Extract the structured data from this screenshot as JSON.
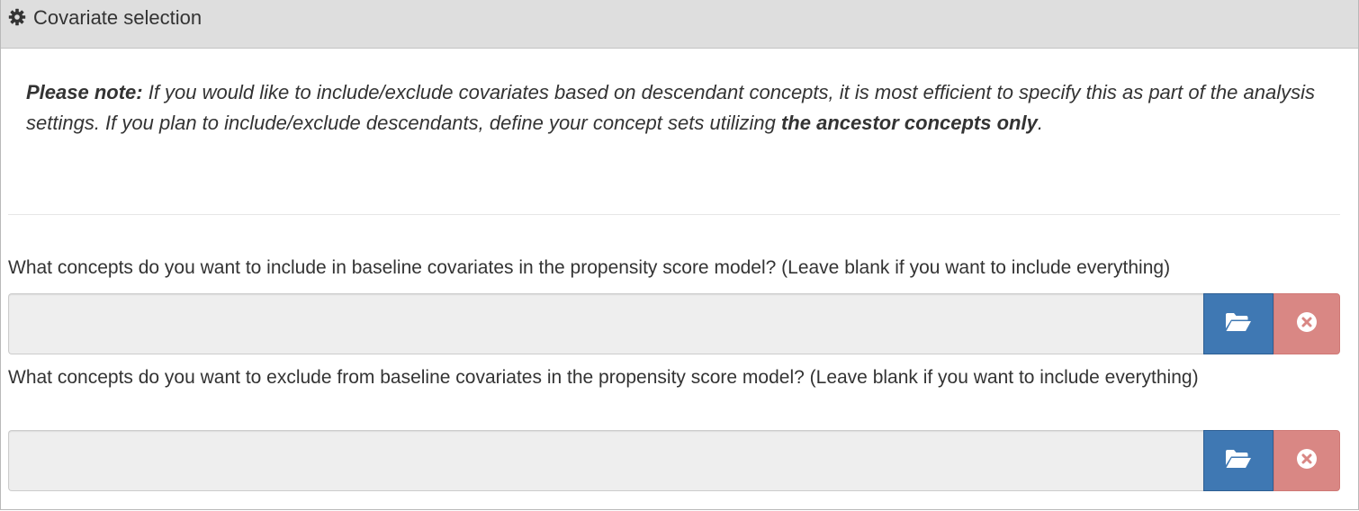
{
  "panel": {
    "icon": "gear-icon",
    "title": "Covariate selection"
  },
  "note": {
    "lead": "Please note:",
    "text_part1": " If you would like to include/exclude covariates based on descendant concepts, it is most efficient to specify this as part of the analysis settings. If you plan to include/exclude descendants, define your concept sets utilizing ",
    "emphasis": "the ancestor concepts only",
    "text_part2": "."
  },
  "include_question": {
    "label": "What concepts do you want to include in baseline covariates in the propensity score model? (Leave blank if you want to include everything)",
    "value": "",
    "open_icon": "folder-open-icon",
    "clear_icon": "times-circle-icon"
  },
  "exclude_question": {
    "label": "What concepts do you want to exclude from baseline covariates in the propensity score model? (Leave blank if you want to include everything)",
    "value": "",
    "open_icon": "folder-open-icon",
    "clear_icon": "times-circle-icon"
  },
  "colors": {
    "heading_bg": "#dedede",
    "open_button": "#3f78b3",
    "clear_button": "#d98784",
    "field_bg": "#eeeeee"
  }
}
